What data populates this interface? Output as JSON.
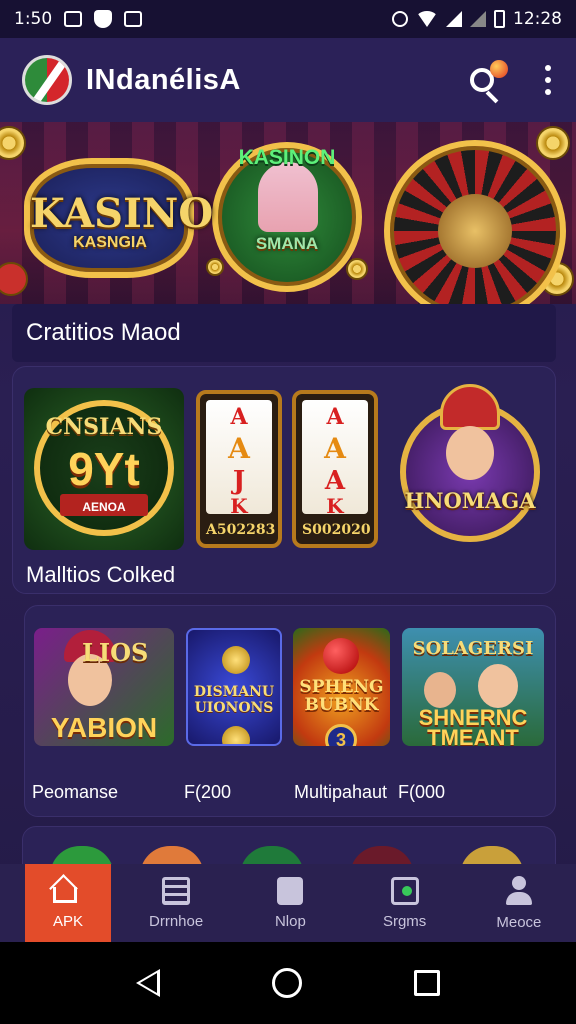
{
  "status_bar": {
    "time": "1:50",
    "right_time": "12:28"
  },
  "app_bar": {
    "title": "INdanélisA",
    "icons": [
      "search-icon",
      "more-vert-icon"
    ]
  },
  "banner": {
    "left_title": "KASINO",
    "left_subtitle": "KASNGIA",
    "center_title": "KASINON",
    "center_subtitle": "SMANA"
  },
  "section1": {
    "title": "Cratitios Maod",
    "tiles": [
      {
        "line1": "CNSIANS",
        "line2": "9Yt",
        "line3": "AENOA"
      },
      {
        "symbols": [
          "A",
          "A",
          "J",
          "K"
        ],
        "code": "A502283"
      },
      {
        "symbols": [
          "A",
          "A",
          "A",
          "K"
        ],
        "code": "S002020"
      },
      {
        "title": "HNOMAGA"
      }
    ],
    "caption": "Malltios Colked"
  },
  "section2": {
    "tiles": [
      {
        "line1": "LIOS",
        "line2": "YABION"
      },
      {
        "line1": "DISMANU UIONONS"
      },
      {
        "line1": "SPHENG BUBNK",
        "badge": "3"
      },
      {
        "line1": "SOLAGERSI",
        "line2": "SHNERNC TMEANT"
      }
    ],
    "captions": [
      "Peomanse",
      "F(200",
      "Multipahaut",
      "F(000"
    ]
  },
  "bottom_nav": [
    {
      "label": "APK",
      "icon": "home-icon",
      "active": true
    },
    {
      "label": "Drrnhoe",
      "icon": "list-icon",
      "active": false
    },
    {
      "label": "Nlop",
      "icon": "bag-icon",
      "active": false
    },
    {
      "label": "Srgms",
      "icon": "find-icon",
      "active": false
    },
    {
      "label": "Meoce",
      "icon": "user-icon",
      "active": false
    }
  ],
  "colors": {
    "background": "#241a4a",
    "app_bar": "#2b2158",
    "accent": "#e34c2a",
    "gold": "#f2c14a"
  }
}
